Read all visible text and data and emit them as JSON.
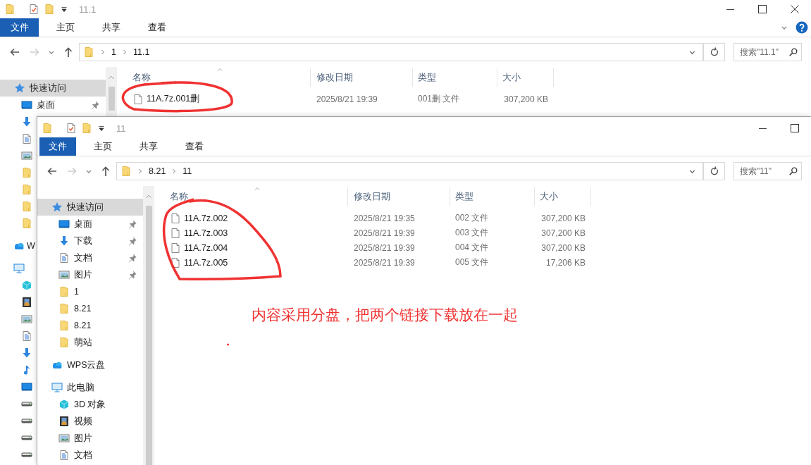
{
  "windows": [
    {
      "title": "11.1",
      "controls": [
        {
          "kind": "minimize"
        },
        {
          "kind": "maximize"
        },
        {
          "kind": "close"
        }
      ],
      "ribbon_tabs": [
        {
          "label": "文件",
          "selected": true
        },
        {
          "label": "主页",
          "selected": false
        },
        {
          "label": "共享",
          "selected": false
        },
        {
          "label": "查看",
          "selected": false
        }
      ],
      "help_button": true,
      "nav_buttons": [
        {
          "kind": "back",
          "disabled": false
        },
        {
          "kind": "forward",
          "disabled": true
        },
        {
          "kind": "recent",
          "disabled": false
        },
        {
          "kind": "up",
          "disabled": false
        }
      ],
      "breadcrumbs": [
        "1",
        "11.1"
      ],
      "search": {
        "placeholder": "搜索\"11.1\""
      },
      "nav": [
        {
          "label": "快速访问",
          "kind": "star",
          "selected": true,
          "children": [
            {
              "label": "桌面",
              "kind": "desktop",
              "pinned": true
            },
            {
              "kind": "download"
            },
            {
              "kind": "doc"
            },
            {
              "kind": "pic"
            },
            {
              "kind": "folder"
            },
            {
              "kind": "folder"
            },
            {
              "kind": "folder"
            },
            {
              "kind": "folder"
            }
          ]
        },
        {
          "label": "W",
          "kind": "cloud",
          "selected": false
        },
        {
          "kind": "pc",
          "selected": false,
          "children": [
            {
              "kind": "cube"
            },
            {
              "kind": "video"
            },
            {
              "kind": "pic"
            },
            {
              "kind": "doc"
            },
            {
              "kind": "download"
            },
            {
              "kind": "music"
            },
            {
              "kind": "desktop"
            },
            {
              "kind": "drive"
            },
            {
              "kind": "drive"
            },
            {
              "kind": "drive"
            },
            {
              "kind": "drive"
            }
          ]
        }
      ],
      "columns": [
        {
          "label": "名称",
          "sorted": true
        },
        {
          "label": "修改日期",
          "sorted": false
        },
        {
          "label": "类型",
          "sorted": false
        },
        {
          "label": "大小",
          "sorted": false
        }
      ],
      "files": [
        {
          "name": "11A.7z.001删",
          "date": "2025/8/21 19:39",
          "type": "001删 文件",
          "size": "307,200 KB"
        }
      ]
    },
    {
      "title": "11",
      "controls": [
        {
          "kind": "minimize"
        },
        {
          "kind": "maximize"
        }
      ],
      "ribbon_tabs": [
        {
          "label": "文件",
          "selected": true
        },
        {
          "label": "主页",
          "selected": false
        },
        {
          "label": "共享",
          "selected": false
        },
        {
          "label": "查看",
          "selected": false
        }
      ],
      "nav_buttons": [
        {
          "kind": "back",
          "disabled": false
        },
        {
          "kind": "forward",
          "disabled": true
        },
        {
          "kind": "recent",
          "disabled": false
        },
        {
          "kind": "up",
          "disabled": false
        }
      ],
      "breadcrumbs": [
        "8.21",
        "11"
      ],
      "search": {
        "placeholder": "搜索\"11\""
      },
      "nav": [
        {
          "label": "快速访问",
          "kind": "star",
          "selected": true,
          "children": [
            {
              "label": "桌面",
              "kind": "desktop",
              "pinned": true
            },
            {
              "label": "下载",
              "kind": "download",
              "pinned": true
            },
            {
              "label": "文档",
              "kind": "doc",
              "pinned": true
            },
            {
              "label": "图片",
              "kind": "pic",
              "pinned": true
            },
            {
              "label": "1",
              "kind": "folder",
              "pinned": false
            },
            {
              "label": "8.21",
              "kind": "folder",
              "pinned": false
            },
            {
              "label": "8.21",
              "kind": "folder",
              "pinned": false
            },
            {
              "label": "萌站",
              "kind": "folder",
              "pinned": false
            }
          ]
        },
        {
          "label": "WPS云盘",
          "kind": "cloud",
          "selected": false
        },
        {
          "label": "此电脑",
          "kind": "pc",
          "selected": false,
          "children": [
            {
              "label": "3D 对象",
              "kind": "cube"
            },
            {
              "label": "视频",
              "kind": "video"
            },
            {
              "label": "图片",
              "kind": "pic"
            },
            {
              "label": "文档",
              "kind": "doc"
            }
          ]
        }
      ],
      "columns": [
        {
          "label": "名称",
          "sorted": true
        },
        {
          "label": "修改日期",
          "sorted": false
        },
        {
          "label": "类型",
          "sorted": false
        },
        {
          "label": "大小",
          "sorted": false
        }
      ],
      "files": [
        {
          "name": "11A.7z.002",
          "date": "2025/8/21 19:35",
          "type": "002 文件",
          "size": "307,200 KB"
        },
        {
          "name": "11A.7z.003",
          "date": "2025/8/21 19:39",
          "type": "003 文件",
          "size": "307,200 KB"
        },
        {
          "name": "11A.7z.004",
          "date": "2025/8/21 19:39",
          "type": "004 文件",
          "size": "307,200 KB"
        },
        {
          "name": "11A.7z.005",
          "date": "2025/8/21 19:39",
          "type": "005 文件",
          "size": "17,206 KB"
        }
      ],
      "annotation": {
        "text": "内容采用分盘，把两个链接下载放在一起"
      }
    }
  ]
}
